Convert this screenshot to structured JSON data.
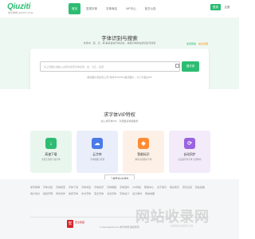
{
  "header": {
    "logo": "Qiuziti",
    "logo_sub": "求字体网 QIUZITI.COM",
    "nav": [
      "首页",
      "发现字体",
      "字体商店",
      "VIP中心",
      "官方公告"
    ],
    "login": "登录",
    "register": "注册"
  },
  "hero": {
    "title": "字体识别与搜索",
    "subtitle": "支持中、英、日、韩 等多语言字体识别，海量字体库在线识别与搜索",
    "top_links": [
      "使用帮助",
      "常见问题"
    ],
    "search_placeholder": "请上传图片或输入关键字搜索字体名称，如：方正、思源",
    "search_button": "搜字体",
    "search_hint": "拖动图片到此处上传 支持JPG/PNG格式图片，大小不超过5M"
  },
  "vip": {
    "title": "求字体VIP特权",
    "subtitle": "加入求字体VIP，享受更多特权服务",
    "cards": [
      {
        "title": "高速下载",
        "desc": "免费无限制下载字体",
        "icon": "download-icon"
      },
      {
        "title": "云字库",
        "desc": "字体收藏与管理",
        "icon": "cloud-icon"
      },
      {
        "title": "智能标识",
        "desc": "精准识别图片字体",
        "icon": "tag-icon"
      },
      {
        "title": "自动同步",
        "desc": "多设备同步字体 立即体验",
        "icon": "sync-icon"
      }
    ],
    "more_button": "了解更多VIP特权"
  },
  "footer": {
    "links": [
      "求字体网",
      "字体识别",
      "字体搜索",
      "字体下载",
      "字体商店",
      "字体资讯",
      "字体教程",
      "字体百科",
      "VIP特权",
      "帮助中心",
      "关于我们",
      "联系我们",
      "意见反馈",
      "隐私政策",
      "用户协议",
      "版权声明",
      "商务合作",
      "免费字体",
      "中文字体",
      "英文字体",
      "书法字体",
      "字体设计",
      "设计素材",
      "网站地图"
    ],
    "badge": "安",
    "badge_text": "安全联盟",
    "copyright": "© www.qiuziti.com 求字体网 版权所有"
  },
  "watermark": "网站收录网",
  "watermark_url": "www.wzsl.cn",
  "colors": {
    "primary": "#2dbd72",
    "accent": "#ff8a00",
    "hero_bg": "#eef8f3"
  }
}
